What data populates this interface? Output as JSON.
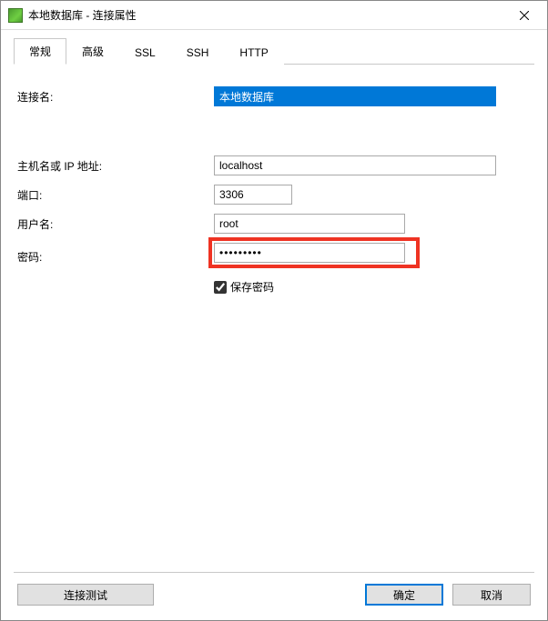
{
  "window": {
    "title": "本地数据库 - 连接属性"
  },
  "tabs": {
    "general": "常规",
    "advanced": "高级",
    "ssl": "SSL",
    "ssh": "SSH",
    "http": "HTTP"
  },
  "labels": {
    "connection_name": "连接名:",
    "host": "主机名或 IP 地址:",
    "port": "端口:",
    "user": "用户名:",
    "password": "密码:",
    "save_password": "保存密码"
  },
  "values": {
    "connection_name": "本地数据库",
    "host": "localhost",
    "port": "3306",
    "user": "root",
    "password": "•••••••••",
    "save_password_checked": true
  },
  "buttons": {
    "test": "连接测试",
    "ok": "确定",
    "cancel": "取消"
  }
}
